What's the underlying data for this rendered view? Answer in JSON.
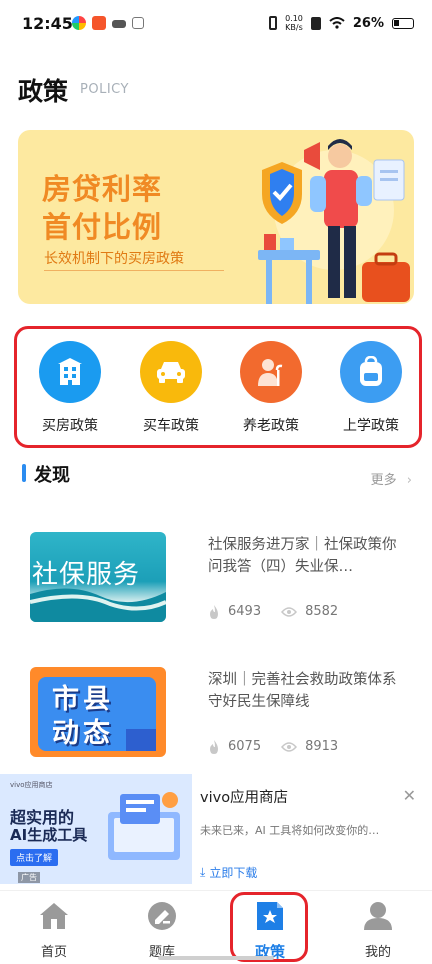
{
  "status_bar": {
    "time": "12:45",
    "net_speed_top": "0.10",
    "net_speed_bottom": "KB/s",
    "battery": "26%"
  },
  "header": {
    "title": "政策",
    "subtitle": "POLICY"
  },
  "banner": {
    "line1": "房贷利率",
    "line2": "首付比例",
    "line3": "长效机制下的买房政策"
  },
  "categories": [
    {
      "label": "买房政策",
      "icon": "building-icon",
      "color": "#1a9bf0"
    },
    {
      "label": "买车政策",
      "icon": "car-icon",
      "color": "#f9b90c"
    },
    {
      "label": "养老政策",
      "icon": "elderly-icon",
      "color": "#f26a2e"
    },
    {
      "label": "上学政策",
      "icon": "backpack-icon",
      "color": "#3c9df2"
    }
  ],
  "discover": {
    "title": "发现",
    "more": "更多"
  },
  "articles": [
    {
      "title": "社保服务进万家｜社保政策你问我答（四）失业保…",
      "thumb_text": "社保服务",
      "likes": "6493",
      "views": "8582"
    },
    {
      "title": "深圳｜完善社会救助政策体系 守好民生保障线",
      "thumb_text_1": "市县",
      "thumb_text_2": "动态",
      "likes": "6075",
      "views": "8913"
    }
  ],
  "ad": {
    "app_name": "vivo应用商店",
    "description": "未来已来，AI 工具将如何改变你的…",
    "cta": "立即下载",
    "img_store": "vivo应用商店",
    "img_line1": "超实用的",
    "img_line2": "AI生成工具",
    "img_button": "点击了解",
    "img_ad_tag": "广告"
  },
  "tabbar": [
    {
      "label": "首页",
      "icon": "home-icon"
    },
    {
      "label": "题库",
      "icon": "question-bank-icon"
    },
    {
      "label": "政策",
      "icon": "policy-icon",
      "active": true
    },
    {
      "label": "我的",
      "icon": "profile-icon"
    }
  ],
  "colors": {
    "accent": "#1e7fe6",
    "highlight_ring": "#e5242b",
    "banner_bg": "#fde9a0",
    "banner_text": "#f08a24"
  }
}
